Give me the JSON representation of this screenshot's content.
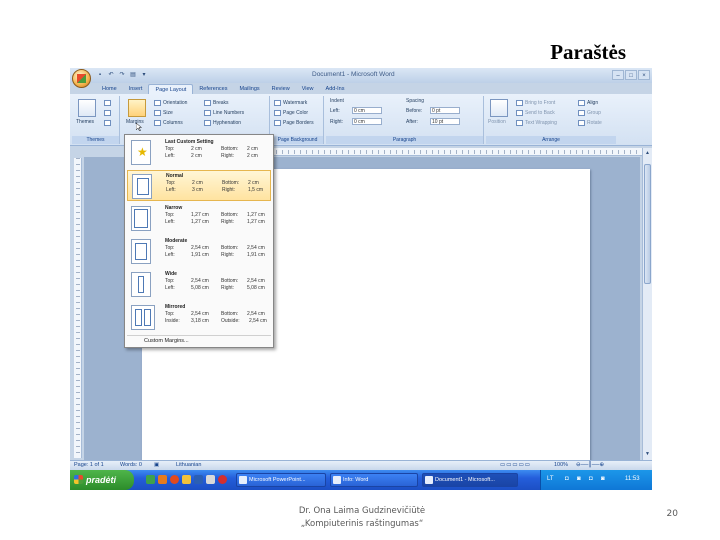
{
  "slide": {
    "title": "Paraštės",
    "footer_line1": "Dr. Ona Laima Gudzinevičiūtė",
    "footer_line2": "„Kompiuterinis raštingumas“",
    "page_number": "20"
  },
  "window": {
    "title": "Document1 - Microsoft Word"
  },
  "ribbon": {
    "tabs": [
      "Home",
      "Insert",
      "Page Layout",
      "References",
      "Mailings",
      "Review",
      "View",
      "Add-Ins"
    ],
    "active_tab": "Page Layout",
    "themes": {
      "label": "Themes",
      "button": "Themes"
    },
    "page_setup": {
      "margins": "Margins",
      "orientation": "Orientation",
      "size": "Size",
      "columns": "Columns",
      "breaks": "Breaks",
      "line_numbers": "Line Numbers",
      "hyphenation": "Hyphenation"
    },
    "page_background": {
      "label": "Page Background",
      "watermark": "Watermark",
      "page_color": "Page Color",
      "page_borders": "Page Borders"
    },
    "paragraph": {
      "label": "Paragraph",
      "indent": "Indent",
      "left_label": "Left:",
      "left_value": "0 cm",
      "right_label": "Right:",
      "right_value": "0 cm",
      "spacing": "Spacing",
      "before_label": "Before:",
      "before_value": "0 pt",
      "after_label": "After:",
      "after_value": "10 pt"
    },
    "arrange": {
      "label": "Arrange",
      "position": "Position",
      "bring_to_front": "Bring to Front",
      "send_to_back": "Send to Back",
      "text_wrapping": "Text Wrapping",
      "align": "Align",
      "group": "Group",
      "rotate": "Rotate"
    }
  },
  "margins_menu": {
    "presets": [
      {
        "name": "Last Custom Setting",
        "top": "2 cm",
        "bottom": "2 cm",
        "left": "2 cm",
        "right": "2 cm",
        "inside_label": "Left:",
        "outside_label": "Right:"
      },
      {
        "name": "Normal",
        "top": "2 cm",
        "bottom": "2 cm",
        "left": "3 cm",
        "right": "1,5 cm",
        "inside_label": "Left:",
        "outside_label": "Right:"
      },
      {
        "name": "Narrow",
        "top": "1,27 cm",
        "bottom": "1,27 cm",
        "left": "1,27 cm",
        "right": "1,27 cm",
        "inside_label": "Left:",
        "outside_label": "Right:"
      },
      {
        "name": "Moderate",
        "top": "2,54 cm",
        "bottom": "2,54 cm",
        "left": "1,91 cm",
        "right": "1,91 cm",
        "inside_label": "Left:",
        "outside_label": "Right:"
      },
      {
        "name": "Wide",
        "top": "2,54 cm",
        "bottom": "2,54 cm",
        "left": "5,08 cm",
        "right": "5,08 cm",
        "inside_label": "Left:",
        "outside_label": "Right:"
      },
      {
        "name": "Mirrored",
        "top": "2,54 cm",
        "bottom": "2,54 cm",
        "left": "3,18 cm",
        "right": "2,54 cm",
        "inside_label": "Inside:",
        "outside_label": "Outside:"
      }
    ],
    "labels": {
      "top": "Top:",
      "bottom": "Bottom:"
    },
    "custom": "Custom Margins..."
  },
  "statusbar": {
    "page": "Page: 1 of 1",
    "words": "Words: 0",
    "language": "Lithuanian",
    "zoom": "100%"
  },
  "taskbar": {
    "start": "pradėti",
    "tasks": [
      "Microsoft PowerPoint...",
      "Info: Word",
      "Document1 - Microsoft..."
    ],
    "lang": "LT",
    "clock": "11:53"
  }
}
